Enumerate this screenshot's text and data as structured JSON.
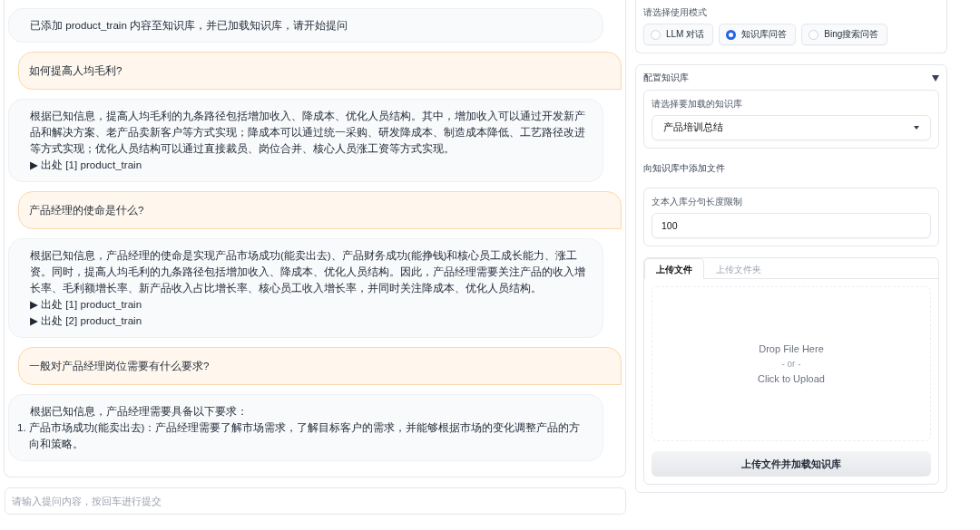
{
  "chat": {
    "messages": [
      {
        "kind": "bot",
        "paragraphs": [
          "已添加 product_train 内容至知识库，并已加载知识库，请开始提问"
        ]
      },
      {
        "kind": "user",
        "paragraphs": [
          "如何提高人均毛利?"
        ]
      },
      {
        "kind": "bot",
        "paragraphs": [
          "根据已知信息，提高人均毛利的九条路径包括增加收入、降成本、优化人员结构。其中，增加收入可以通过开发新产品和解决方案、老产品卖新客户等方式实现；降成本可以通过统一采购、研发降成本、制造成本降低、工艺路径改进等方式实现；优化人员结构可以通过直接裁员、岗位合并、核心人员涨工资等方式实现。"
        ],
        "sources": [
          "▶ 出处 [1] product_train"
        ]
      },
      {
        "kind": "user",
        "paragraphs": [
          "产品经理的使命是什么?"
        ]
      },
      {
        "kind": "bot",
        "paragraphs": [
          "根据已知信息，产品经理的使命是实现产品市场成功(能卖出去)、产品财务成功(能挣钱)和核心员工成长能力、涨工资。同时，提高人均毛利的九条路径包括增加收入、降成本、优化人员结构。因此，产品经理需要关注产品的收入增长率、毛利额增长率、新产品收入占比增长率、核心员工收入增长率，并同时关注降成本、优化人员结构。"
        ],
        "sources": [
          "▶ 出处 [1] product_train",
          "▶ 出处 [2] product_train"
        ]
      },
      {
        "kind": "user",
        "paragraphs": [
          "一般对产品经理岗位需要有什么要求?"
        ]
      },
      {
        "kind": "bot",
        "paragraphs": [
          "根据已知信息，产品经理需要具备以下要求："
        ],
        "list": [
          {
            "number": "1.",
            "text": "产品市场成功(能卖出去)：产品经理需要了解市场需求，了解目标客户的需求，并能够根据市场的变化调整产品的方向和策略。"
          }
        ]
      }
    ]
  },
  "input": {
    "placeholder": "请输入提问内容，按回车进行提交"
  },
  "mode": {
    "label": "请选择使用模式",
    "options": [
      {
        "label": "LLM 对话",
        "selected": false
      },
      {
        "label": "知识库问答",
        "selected": true
      },
      {
        "label": "Bing搜索问答",
        "selected": false
      }
    ]
  },
  "knowledge": {
    "title": "配置知识库",
    "expanded": true,
    "select": {
      "label": "请选择要加载的知识库",
      "value": "产品培训总结"
    },
    "add_heading": "向知识库中添加文件",
    "chunk": {
      "label": "文本入库分句长度限制",
      "value": "100"
    },
    "tabs": [
      {
        "label": "上传文件",
        "selected": true
      },
      {
        "label": "上传文件夹",
        "selected": false
      }
    ],
    "dropzone": [
      "Drop File Here",
      "- or -",
      "Click to Upload"
    ],
    "button": "上传文件并加载知识库"
  }
}
